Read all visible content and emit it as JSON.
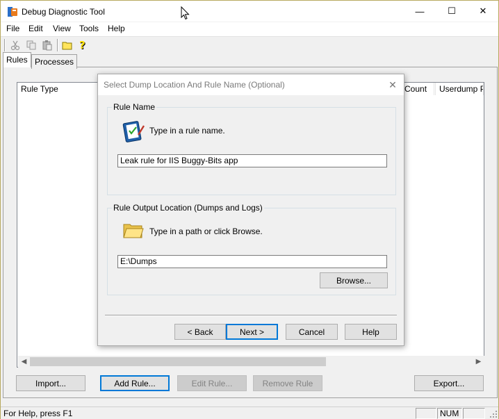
{
  "app": {
    "title": "Debug Diagnostic Tool",
    "caption_buttons": {
      "minimize": "—",
      "maximize": "☐",
      "close": "✕"
    }
  },
  "menu": [
    "File",
    "Edit",
    "View",
    "Tools",
    "Help"
  ],
  "toolbar": {
    "icons": [
      "cut-icon",
      "copy-icon",
      "paste-icon",
      "open-folder-icon",
      "help-icon"
    ]
  },
  "tabs": [
    {
      "label": "Rules",
      "active": true
    },
    {
      "label": "Processes",
      "active": false
    }
  ],
  "rules_list": {
    "columns": [
      "Rule Type",
      "Count",
      "Userdump Pa"
    ]
  },
  "bottom_buttons": {
    "import": "Import...",
    "add_rule": "Add Rule...",
    "edit_rule": "Edit Rule...",
    "remove_rule": "Remove Rule",
    "export": "Export..."
  },
  "status": {
    "help_text": "For Help, press F1",
    "num": "NUM"
  },
  "dialog": {
    "title": "Select Dump Location And Rule Name (Optional)",
    "close": "✕",
    "rule_name_group": {
      "label": "Rule Name",
      "instruction": "Type in a rule name.",
      "value": "Leak rule for IIS Buggy-Bits app"
    },
    "output_group": {
      "label": "Rule Output Location (Dumps and Logs)",
      "instruction": "Type in a path or click Browse.",
      "value": "E:\\Dumps",
      "browse": "Browse..."
    },
    "buttons": {
      "back": "< Back",
      "next": "Next >",
      "cancel": "Cancel",
      "help": "Help"
    }
  },
  "colors": {
    "focus_border": "#0078d7",
    "face": "#f0f0f0",
    "window_border": "#b7a95f"
  }
}
